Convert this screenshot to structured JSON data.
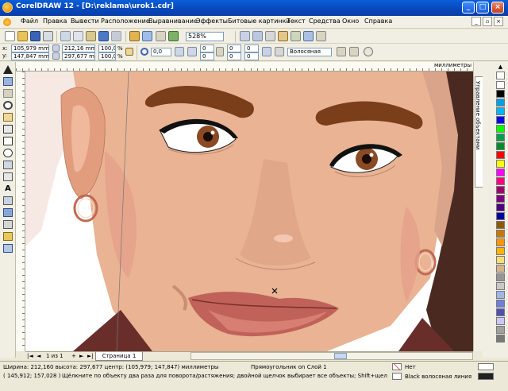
{
  "window": {
    "title": "CorelDRAW 12 - [D:\\reklama\\urok1.cdr]",
    "minimize": "_",
    "maximize": "□",
    "close": "×"
  },
  "menu": {
    "items": [
      "Файл",
      "Правка",
      "Вывести",
      "Расположение",
      "Выравнивание",
      "Эффекты",
      "Битовые картинки",
      "Текст",
      "Средства",
      "Окно",
      "Справка"
    ],
    "doc_minimize": "_",
    "doc_restore": "▫",
    "doc_close": "×"
  },
  "standard_toolbar": {
    "zoom_value": "528%"
  },
  "property_bar": {
    "x_label": "x:",
    "x_value": "105,979 mm",
    "y_label": "y:",
    "y_value": "147,847 mm",
    "width_value": "212,16 mm",
    "height_value": "297,677 mm",
    "scale_x": "100,0",
    "scale_y": "100,0",
    "percent": "%",
    "rotation": "0,0",
    "corner_values": [
      "0",
      "0",
      "0",
      "0"
    ],
    "outline_values": [
      "0",
      "0"
    ],
    "outline_width": "Волосяная"
  },
  "ruler": {
    "unit": "миллиметры"
  },
  "docker": {
    "tab_label": "Управление объектами"
  },
  "page_nav": {
    "first": "|◄",
    "prev": "◄",
    "counter": "1 из 1",
    "next": "►",
    "last": "►|",
    "add": "+",
    "page_tab": "Страница 1"
  },
  "status": {
    "line1": "Ширина: 212,160  высота: 297,677  центр: (105,979; 147,847)  миллиметры",
    "selection": "Прямоугольник on Слой 1",
    "line2": "Щёлкните по объекту два раза для поворота/растяжения; двойной щелчок выбирает все объекты; Shift+щелчок - выбор не...",
    "coords": "( 145,912; 157,028 )",
    "fill_label": "Нет",
    "outline_label": "Black  волосяная линия"
  },
  "palette": {
    "colors": [
      "#ffffff",
      "#000000",
      "#00a0e6",
      "#00b4ff",
      "#0000ff",
      "#00ff00",
      "#00a04a",
      "#008c2d",
      "#ff0000",
      "#ffff00",
      "#ff00ff",
      "#ff007f",
      "#a0006e",
      "#7d007d",
      "#4b0082",
      "#0000a0",
      "#8c5a00",
      "#c87800",
      "#ff9600",
      "#ffb400",
      "#ffdc78",
      "#d2b48c",
      "#969696",
      "#c8c8c8",
      "#9fb6e6",
      "#6c7fd9",
      "#5050b4",
      "#c8c8ff",
      "#a0a0a0",
      "#787878"
    ]
  }
}
